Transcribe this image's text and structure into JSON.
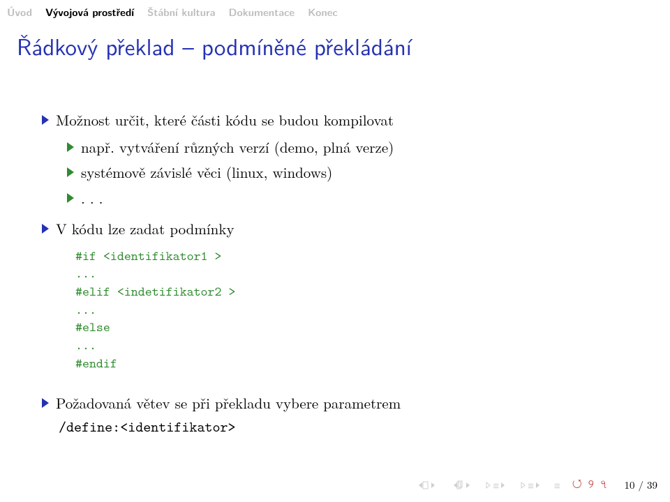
{
  "nav": {
    "items": [
      {
        "label": "Úvod",
        "current": false
      },
      {
        "label": "Vývojová prostředí",
        "current": true
      },
      {
        "label": "Štábní kultura",
        "current": false
      },
      {
        "label": "Dokumentace",
        "current": false
      },
      {
        "label": "Konec",
        "current": false
      }
    ]
  },
  "slide": {
    "title": "Řádkový překlad – podmíněné překládání",
    "bullets": {
      "b1": "Možnost určit, které části kódu se budou kompilovat",
      "b1a": "např. vytváření různých verzí (demo, plná verze)",
      "b1b": "systémově závislé věci (linux, windows)",
      "b1c": ". . .",
      "b2": "V kódu lze zadat podmínky",
      "code": "#if <identifikator1 >\n...\n#elif <indetifikator2 >\n...\n#else\n...\n#endif",
      "b3_prefix": "Požadovaná větev se při překladu vybere parametrem",
      "b3_code": "/define:<identifikator>"
    }
  },
  "footer": {
    "page": "10 / 39",
    "loop": "↺ ↪ ↭"
  }
}
